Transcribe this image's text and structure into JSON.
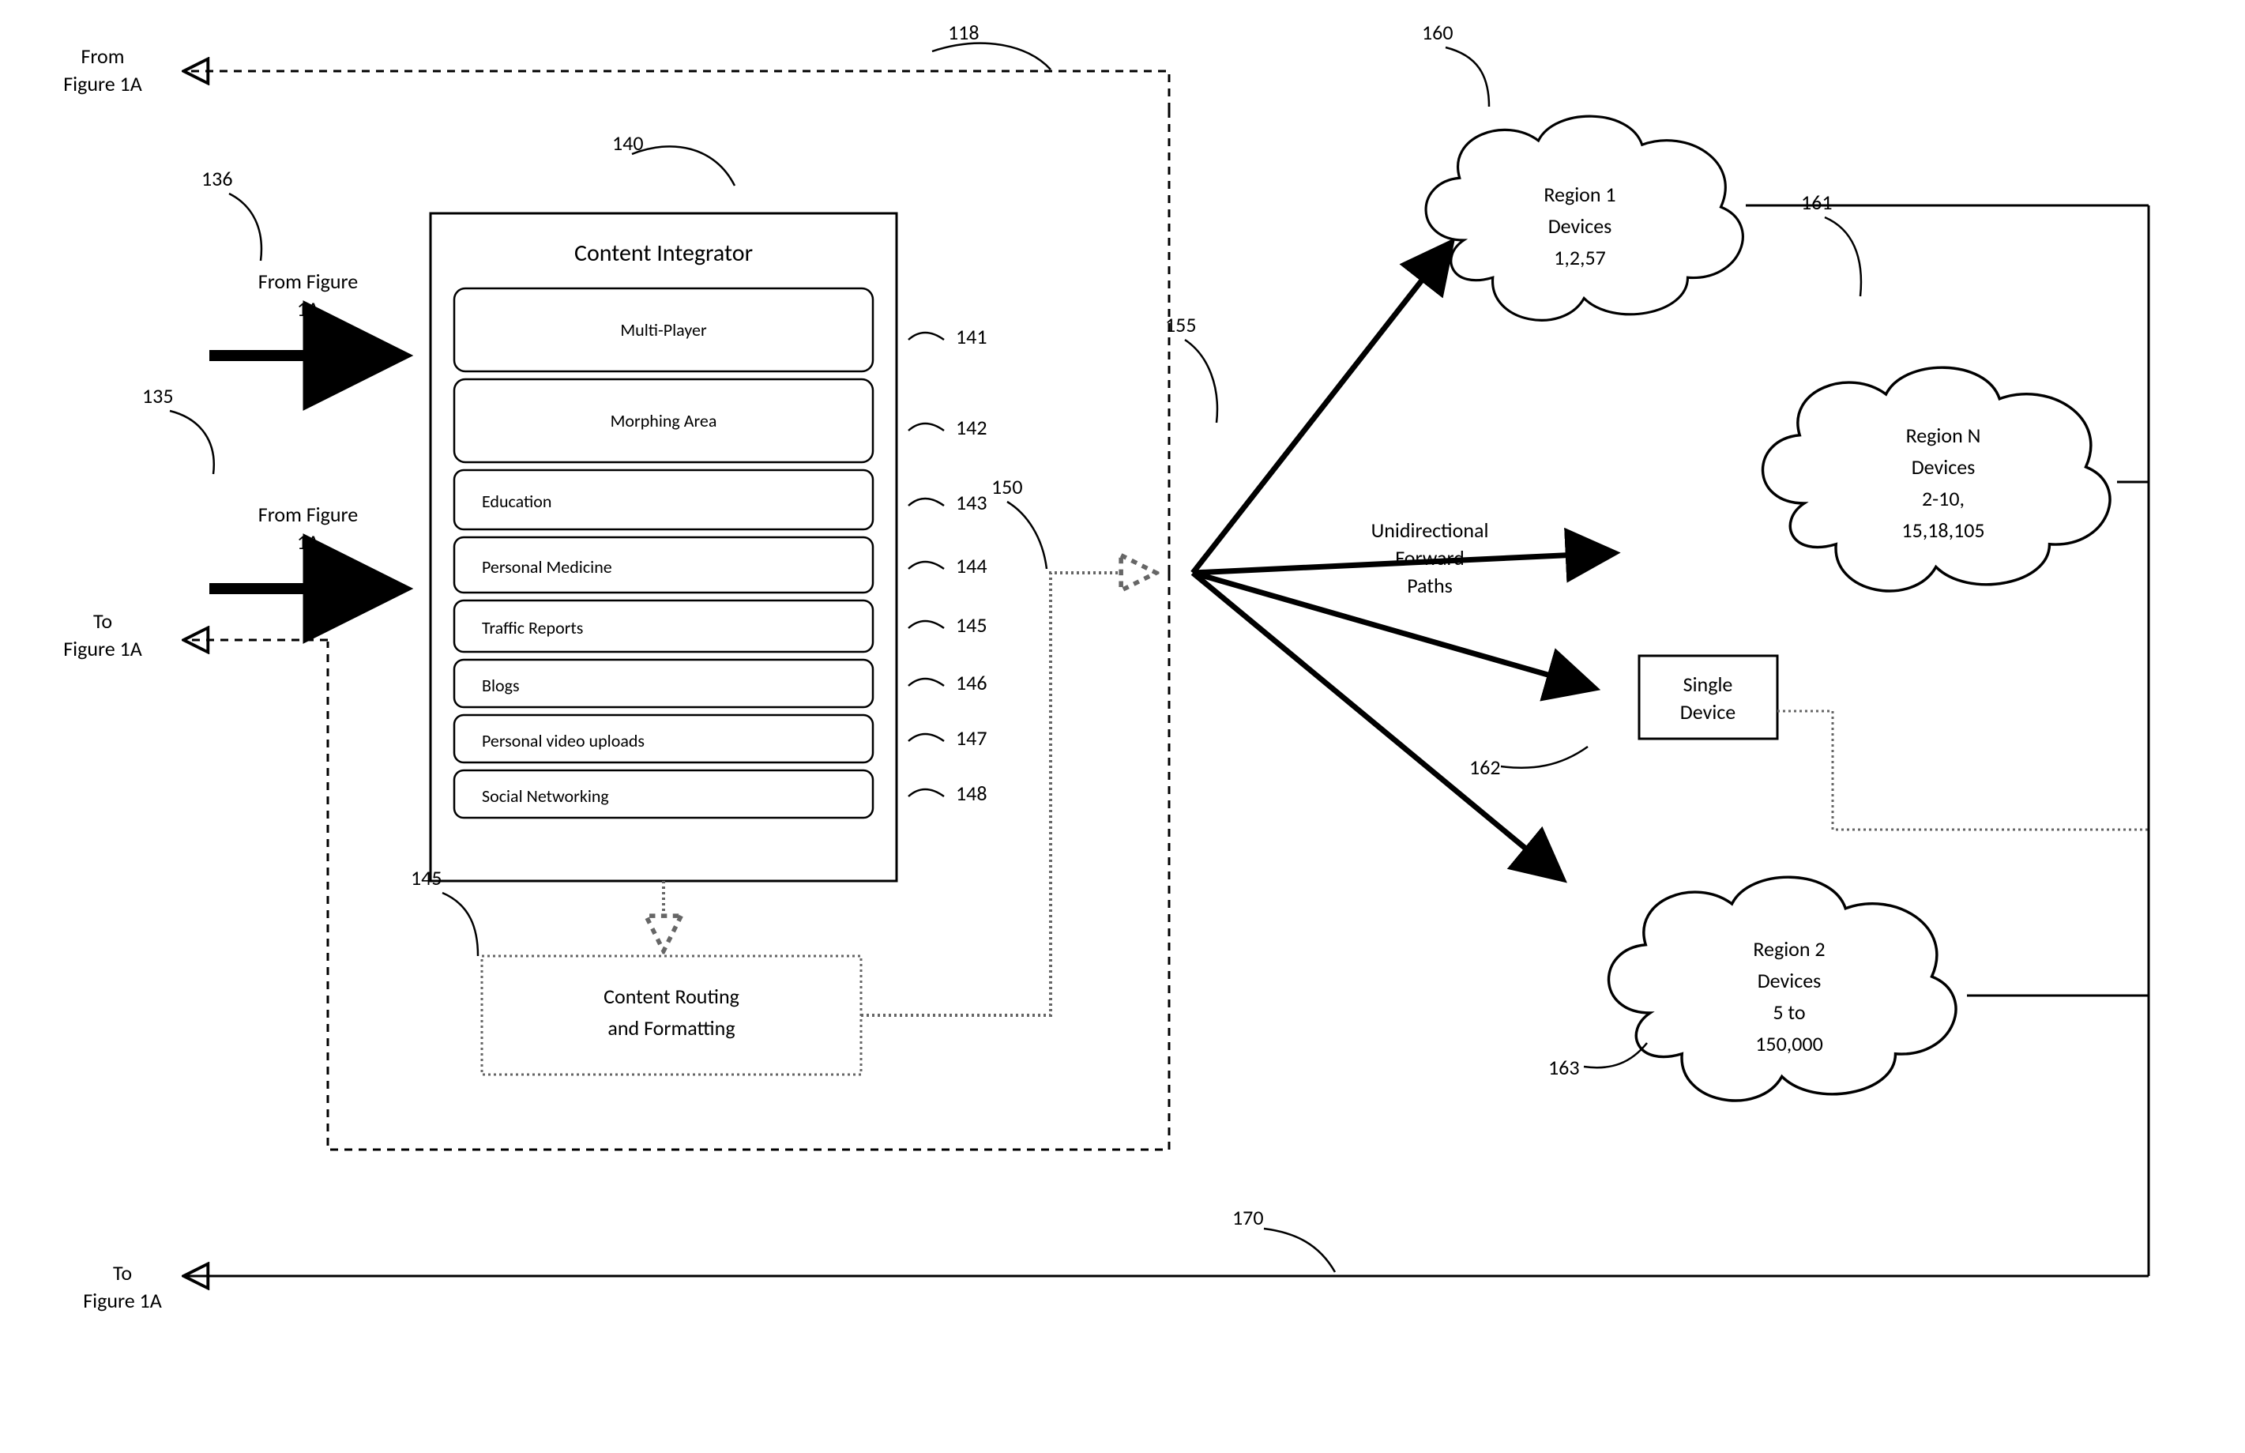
{
  "refs": {
    "r140": "140",
    "r141": "141",
    "r142": "142",
    "r143": "143",
    "r144": "144",
    "r145a": "145",
    "r145b": "145",
    "r146": "146",
    "r147": "147",
    "r148": "148",
    "r150": "150",
    "r155": "155",
    "r160": "160",
    "r161": "161",
    "r162": "162",
    "r163": "163",
    "r170": "170",
    "r118": "118",
    "r135": "135",
    "r136": "136"
  },
  "captions": {
    "fromFig_top": "From\nFigure 1A",
    "fromFig_136": "From Figure\n1A",
    "fromFig_135": "From Figure\n1A",
    "toFig_mid": "To\nFigure 1A",
    "toFig_bottom": "To\nFigure 1A"
  },
  "integrator": {
    "title": "Content Integrator",
    "rows": [
      "Multi-Player",
      "Morphing Area",
      "Education",
      "Personal Medicine",
      "Traffic Reports",
      "Blogs",
      "Personal video uploads",
      "Social Networking"
    ]
  },
  "routing": {
    "title": "Content Routing\nand Formatting"
  },
  "forward": {
    "title": "Unidirectional\nForward\nPaths"
  },
  "clouds": {
    "region1": "Region 1\nDevices\n1,2,57",
    "regionN": "Region N\nDevices\n2-10,\n15,18,105",
    "region2": "Region 2\nDevices\n5 to\n150,000"
  },
  "singleDevice": "Single\nDevice"
}
